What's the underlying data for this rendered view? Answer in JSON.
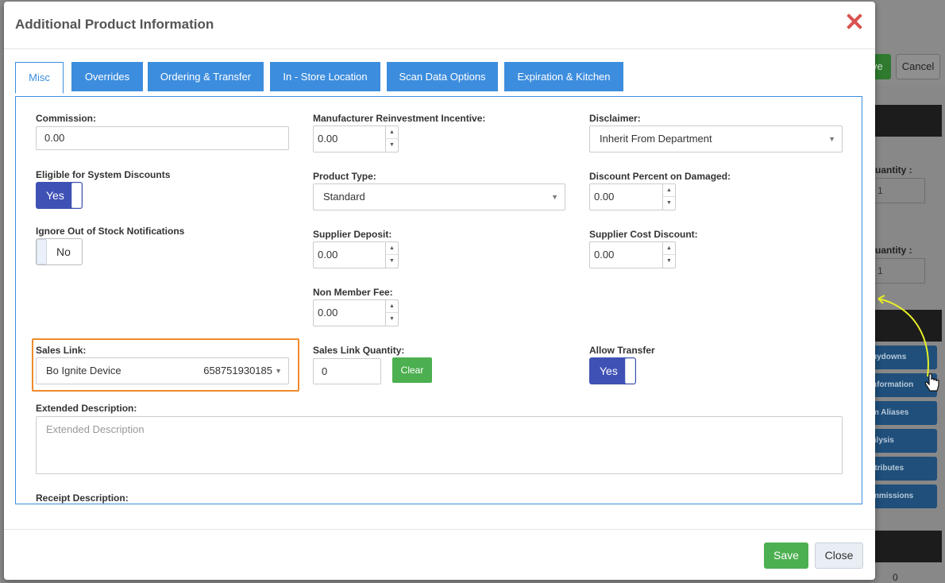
{
  "background": {
    "save_label": "ve",
    "cancel_label": "Cancel",
    "quantity_label_1": "uantity :",
    "quantity_value_1": "1",
    "quantity_label_2": "uantity :",
    "quantity_value_2": "1",
    "side_buttons": [
      "uydowns",
      "nformation",
      "m Aliases",
      "alysis",
      "ttributes",
      "mmissions"
    ],
    "bottom_value": "0"
  },
  "modal": {
    "title": "Additional Product Information",
    "tabs": [
      {
        "label": "Misc",
        "active": true
      },
      {
        "label": "Overrides",
        "active": false
      },
      {
        "label": "Ordering & Transfer",
        "active": false
      },
      {
        "label": "In - Store Location",
        "active": false
      },
      {
        "label": "Scan Data Options",
        "active": false
      },
      {
        "label": "Expiration & Kitchen",
        "active": false
      }
    ],
    "fields": {
      "commission": {
        "label": "Commission:",
        "value": "0.00"
      },
      "eligible_discounts": {
        "label": "Eligible for System Discounts",
        "toggle": "Yes"
      },
      "ignore_oos": {
        "label": "Ignore Out of Stock Notifications",
        "toggle": "No"
      },
      "mfr_incentive": {
        "label": "Manufacturer Reinvestment Incentive:",
        "value": "0.00"
      },
      "product_type": {
        "label": "Product Type:",
        "value": "Standard"
      },
      "supplier_deposit": {
        "label": "Supplier Deposit:",
        "value": "0.00"
      },
      "non_member_fee": {
        "label": "Non Member Fee:",
        "value": "0.00"
      },
      "disclaimer": {
        "label": "Disclaimer:",
        "value": "Inherit From Department"
      },
      "discount_damaged": {
        "label": "Discount Percent on Damaged:",
        "value": "0.00"
      },
      "supplier_cost_discount": {
        "label": "Supplier Cost Discount:",
        "value": "0.00"
      },
      "sales_link": {
        "label": "Sales Link:",
        "name": "Bo Ignite Device",
        "code": "658751930185"
      },
      "sales_link_qty": {
        "label": "Sales Link Quantity:",
        "value": "0",
        "clear_label": "Clear"
      },
      "allow_transfer": {
        "label": "Allow Transfer",
        "toggle": "Yes"
      },
      "extended_description": {
        "label": "Extended Description:",
        "placeholder": "Extended Description"
      },
      "receipt_description": {
        "label": "Receipt Description:"
      }
    },
    "footer": {
      "save_label": "Save",
      "close_label": "Close"
    }
  },
  "colors": {
    "tab_blue": "#3c8dde",
    "toggle_on": "#3f51b5",
    "success_green": "#4caf50",
    "close_red": "#d9534f",
    "highlight_orange": "#f08a2c"
  }
}
